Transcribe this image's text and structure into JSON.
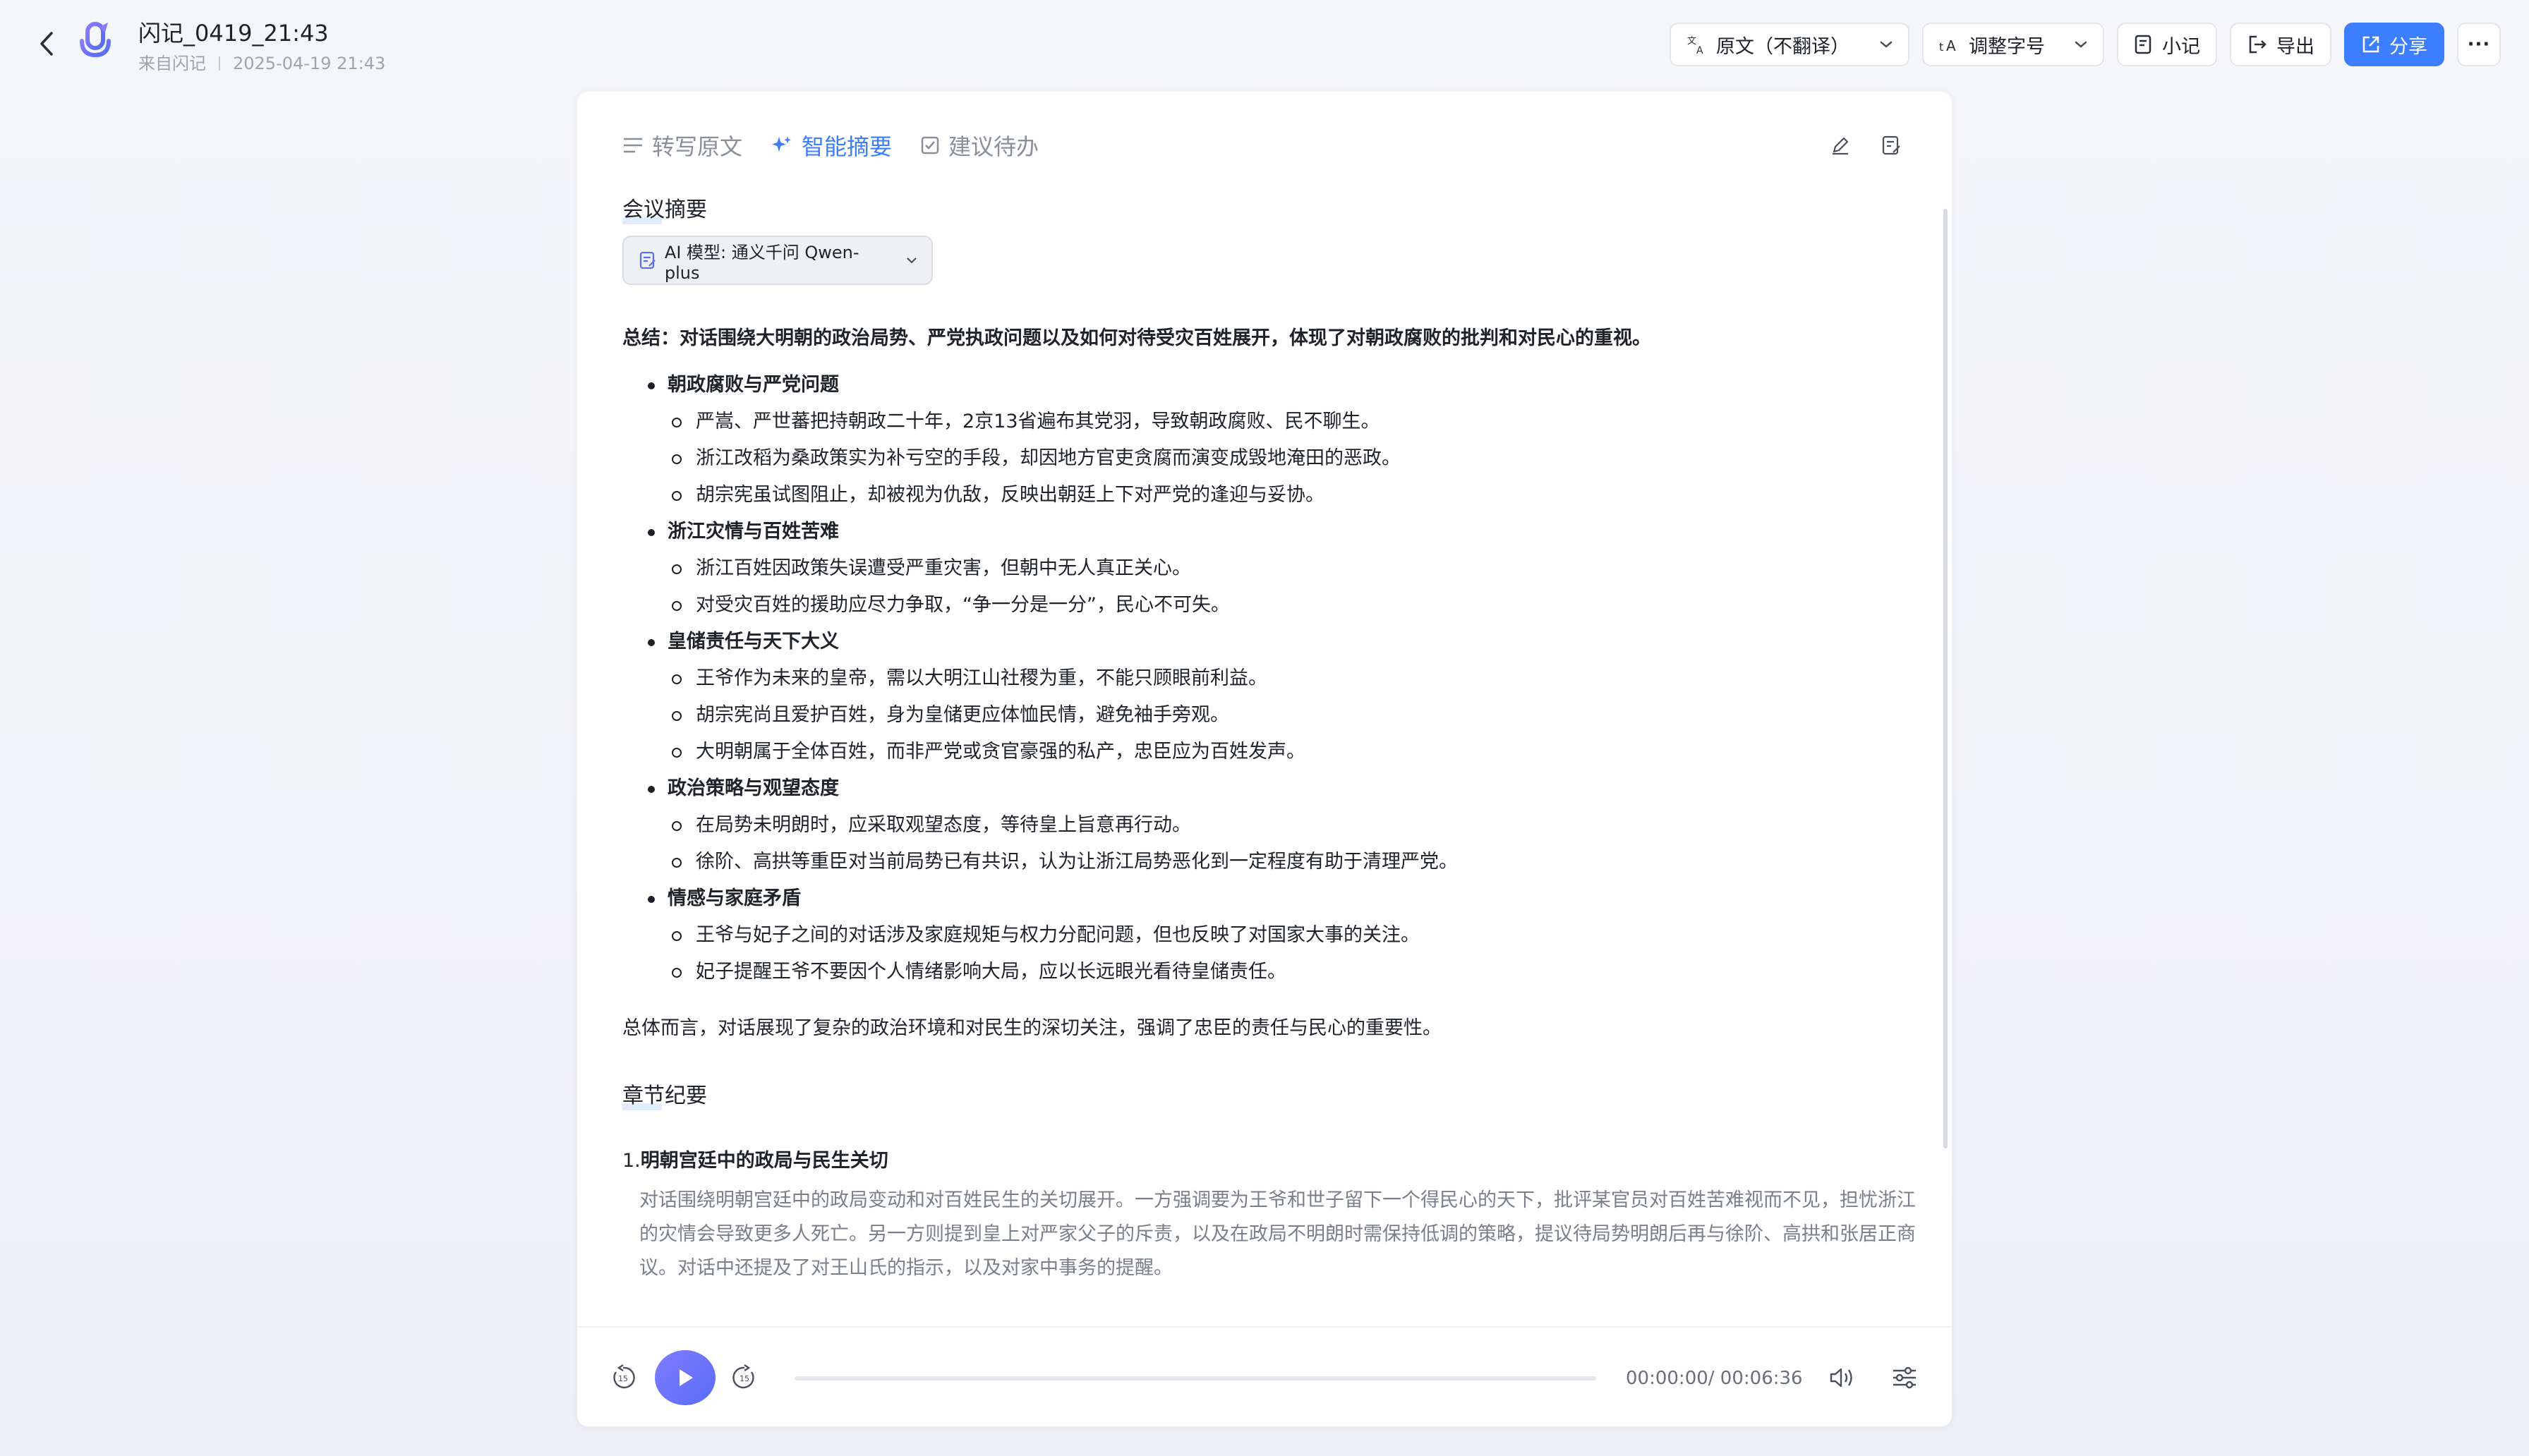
{
  "header": {
    "back_icon": "chevron-left-icon",
    "title": "闪记_0419_21:43",
    "source": "来自闪记",
    "datetime": "2025-04-19 21:43"
  },
  "toolbar": {
    "language_select": "原文（不翻译）",
    "font_size_select": "调整字号",
    "notes_label": "小记",
    "export_label": "导出",
    "share_label": "分享",
    "more_label": "···"
  },
  "tabs": [
    {
      "label": "转写原文",
      "active": false
    },
    {
      "label": "智能摘要",
      "active": true
    },
    {
      "label": "建议待办",
      "active": false
    }
  ],
  "summary_section": {
    "title": "会议摘要",
    "model_label": "AI 模型: 通义千问 Qwen-plus",
    "summary": "总结：对话围绕大明朝的政治局势、严党执政问题以及如何对待受灾百姓展开，体现了对朝政腐败的批判和对民心的重视。",
    "points": [
      {
        "heading": "朝政腐败与严党问题",
        "items": [
          "严嵩、严世蕃把持朝政二十年，2京13省遍布其党羽，导致朝政腐败、民不聊生。",
          "浙江改稻为桑政策实为补亏空的手段，却因地方官吏贪腐而演变成毁地淹田的恶政。",
          "胡宗宪虽试图阻止，却被视为仇敌，反映出朝廷上下对严党的逢迎与妥协。"
        ]
      },
      {
        "heading": "浙江灾情与百姓苦难",
        "items": [
          "浙江百姓因政策失误遭受严重灾害，但朝中无人真正关心。",
          "对受灾百姓的援助应尽力争取，“争一分是一分”，民心不可失。"
        ]
      },
      {
        "heading": "皇储责任与天下大义",
        "items": [
          "王爷作为未来的皇帝，需以大明江山社稷为重，不能只顾眼前利益。",
          "胡宗宪尚且爱护百姓，身为皇储更应体恤民情，避免袖手旁观。",
          "大明朝属于全体百姓，而非严党或贪官豪强的私产，忠臣应为百姓发声。"
        ]
      },
      {
        "heading": "政治策略与观望态度",
        "items": [
          "在局势未明朗时，应采取观望态度，等待皇上旨意再行动。",
          "徐阶、高拱等重臣对当前局势已有共识，认为让浙江局势恶化到一定程度有助于清理严党。"
        ]
      },
      {
        "heading": "情感与家庭矛盾",
        "items": [
          "王爷与妃子之间的对话涉及家庭规矩与权力分配问题，但也反映了对国家大事的关注。",
          "妃子提醒王爷不要因个人情绪影响大局，应以长远眼光看待皇储责任。"
        ]
      }
    ],
    "conclusion": "总体而言，对话展现了复杂的政治环境和对民生的深切关注，强调了忠臣的责任与民心的重要性。"
  },
  "chapter_section": {
    "title": "章节纪要",
    "items": [
      {
        "number": "1.",
        "title": "明朝宫廷中的政局与民生关切",
        "body": "对话围绕明朝宫廷中的政局变动和对百姓民生的关切展开。一方强调要为王爷和世子留下一个得民心的天下，批评某官员对百姓苦难视而不见，担忧浙江的灾情会导致更多人死亡。另一方则提到皇上对严家父子的斥责，以及在政局不明朗时需保持低调的策略，提议待局势明朗后再与徐阶、高拱和张居正商议。对话中还提及了对王山氏的指示，以及对家中事务的提醒。"
      }
    ]
  },
  "player": {
    "skip_back_label": "15",
    "skip_forward_label": "15",
    "current_time": "00:00:00",
    "total_time": "/ 00:06:36",
    "progress": 0
  },
  "colors": {
    "accent": "#3d7eff",
    "play_gradient_start": "#7f7cff",
    "play_gradient_end": "#5a6cf8"
  }
}
